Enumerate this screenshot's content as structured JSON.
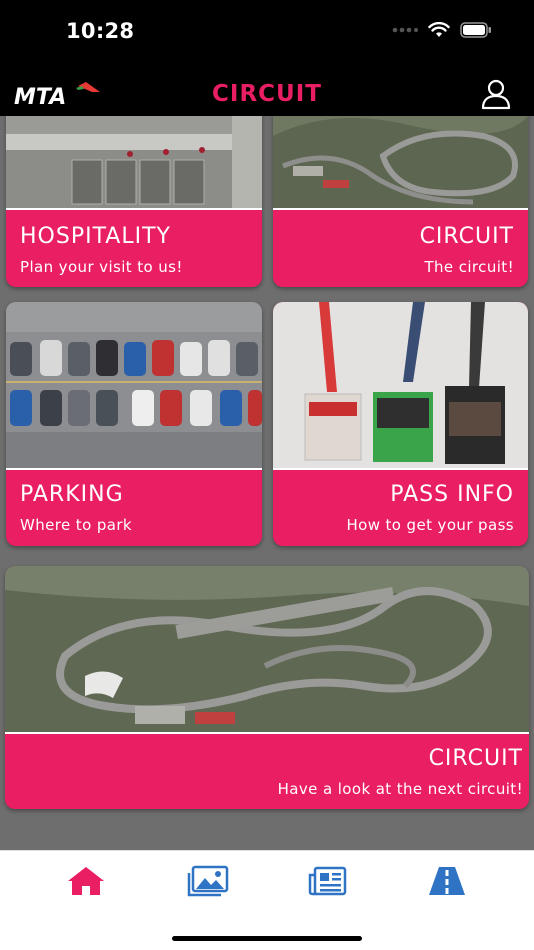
{
  "status_bar": {
    "time": "10:28"
  },
  "header": {
    "logo_text": "MTA",
    "title": "CIRCUIT"
  },
  "cards": [
    {
      "title": "HOSPITALITY",
      "subtitle": "Plan your visit to us!",
      "image": "hospitality-kitchen-photo"
    },
    {
      "title": "CIRCUIT",
      "subtitle": "The circuit!",
      "image": "circuit-aerial-photo"
    },
    {
      "title": "PARKING",
      "subtitle": "Where to park",
      "image": "parking-lot-photo"
    },
    {
      "title": "PASS INFO",
      "subtitle": "How to get your pass",
      "image": "passes-lanyards-photo"
    },
    {
      "title": "CIRCUIT",
      "subtitle": "Have a look at the next circuit!",
      "image": "circuit-aerial-wide-photo"
    }
  ],
  "tab_bar": {
    "tabs": [
      {
        "icon": "home-icon",
        "active": true
      },
      {
        "icon": "gallery-icon",
        "active": false
      },
      {
        "icon": "news-icon",
        "active": false
      },
      {
        "icon": "road-icon",
        "active": false
      }
    ]
  },
  "colors": {
    "accent": "#e91e63",
    "tab_active": "#e91e63",
    "tab_inactive": "#2f73c4",
    "content_bg": "#6e6e6e"
  }
}
